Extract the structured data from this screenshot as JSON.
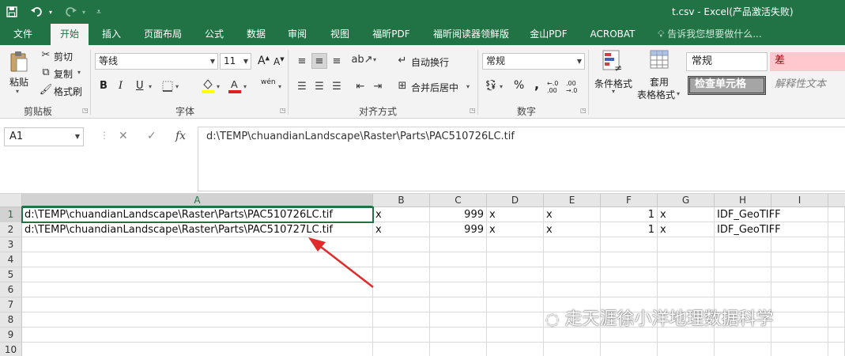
{
  "window": {
    "title": "t.csv - Excel(产品激活失败)"
  },
  "qat": {
    "save_icon": "save-icon",
    "undo_icon": "undo-icon",
    "redo_icon": "redo-icon",
    "customize_icon": "customize-icon"
  },
  "tabs": {
    "file": "文件",
    "home": "开始",
    "insert": "插入",
    "page_layout": "页面布局",
    "formulas": "公式",
    "data": "数据",
    "review": "审阅",
    "view": "视图",
    "foxit_pdf": "福昕PDF",
    "foxit_reader": "福昕阅读器领鲜版",
    "kingsoft_pdf": "金山PDF",
    "acrobat": "ACROBAT",
    "tell_me": "告诉我您想要做什么..."
  },
  "ribbon": {
    "clipboard": {
      "paste": "粘贴",
      "cut": "剪切",
      "copy": "复制",
      "format_painter": "格式刷",
      "label": "剪贴板"
    },
    "font": {
      "font_name": "等线",
      "font_size": "11",
      "bold": "B",
      "italic": "I",
      "underline": "U",
      "phonetic": "wén",
      "label": "字体"
    },
    "alignment": {
      "wrap_text": "自动换行",
      "merge_center": "合并后居中",
      "label": "对齐方式"
    },
    "number": {
      "format": "常规",
      "label": "数字"
    },
    "styles": {
      "conditional_formatting": "条件格式",
      "format_as_table_1": "套用",
      "format_as_table_2": "表格格式",
      "normal": "常规",
      "bad": "差",
      "check_cell": "检查单元格",
      "explanatory": "解释性文本"
    }
  },
  "formula_bar": {
    "name_box": "A1",
    "cancel": "✕",
    "enter": "✓",
    "fx": "fx",
    "content": "d:\\TEMP\\chuandianLandscape\\Raster\\Parts\\PAC510726LC.tif"
  },
  "sheet": {
    "columns": [
      "A",
      "B",
      "C",
      "D",
      "E",
      "F",
      "G",
      "H",
      "I"
    ],
    "row_numbers": [
      "1",
      "2",
      "3",
      "4",
      "5",
      "6",
      "7",
      "8",
      "9",
      "10"
    ],
    "rows": [
      [
        "d:\\TEMP\\chuandianLandscape\\Raster\\Parts\\PAC510726LC.tif",
        "x",
        "999",
        "x",
        "x",
        "1",
        "x",
        "IDF_GeoTIFF",
        ""
      ],
      [
        "d:\\TEMP\\chuandianLandscape\\Raster\\Parts\\PAC510727LC.tif",
        "x",
        "999",
        "x",
        "x",
        "1",
        "x",
        "IDF_GeoTIFF",
        ""
      ]
    ]
  },
  "watermark": "走天涯徐小洋地理数据科学",
  "colors": {
    "excel_green": "#217346",
    "annotation_red": "#e02b2b",
    "bad_style_bg": "#ffc7ce",
    "bad_style_text": "#9c0006"
  }
}
